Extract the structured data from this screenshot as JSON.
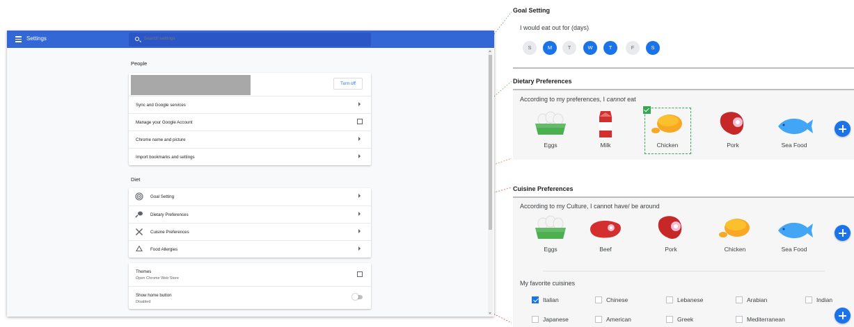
{
  "header": {
    "title": "Settings"
  },
  "search": {
    "placeholder": "Search settings"
  },
  "people": {
    "title": "People",
    "turn_off_label": "Turn off",
    "rows": [
      {
        "label": "Sync and Google services",
        "icon": "arrow-right-icon"
      },
      {
        "label": "Manage your Google Account",
        "icon": "open-external-icon"
      },
      {
        "label": "Chrome name and picture",
        "icon": "arrow-right-icon"
      },
      {
        "label": "Import bookmarks and settings",
        "icon": "arrow-right-icon"
      }
    ]
  },
  "diet": {
    "title": "Diet",
    "rows": [
      {
        "label": "Goal Setting",
        "icon": "target-icon"
      },
      {
        "label": "Dietary Preferences",
        "icon": "drumstick-icon"
      },
      {
        "label": "Cuisine Preferences",
        "icon": "utensils-icon"
      },
      {
        "label": "Food Allergies",
        "icon": "recycle-icon"
      }
    ]
  },
  "appearance": {
    "rows": [
      {
        "title": "Themes",
        "subtitle": "Open Chrome Web Store"
      },
      {
        "title": "Show home button",
        "subtitle": "Disabled"
      }
    ]
  },
  "goal_setting": {
    "title": "Goal Setting",
    "prompt": "I would eat out for (days)",
    "days": [
      {
        "label": "S",
        "selected": false
      },
      {
        "label": "M",
        "selected": true
      },
      {
        "label": "T",
        "selected": false
      },
      {
        "label": "W",
        "selected": true
      },
      {
        "label": "T",
        "selected": true
      },
      {
        "label": "F",
        "selected": false
      },
      {
        "label": "S",
        "selected": true
      }
    ]
  },
  "dietary_preferences": {
    "title": "Dietary Preferences",
    "prompt_before": "According to my preferences, I ",
    "prompt_emph": "cannot",
    "prompt_after": " eat",
    "items": [
      "Eggs",
      "Milk",
      "Chicken",
      "Pork",
      "Sea Food"
    ],
    "selected": "Chicken"
  },
  "cuisine_preferences": {
    "title": "Cuisine Preferences",
    "prompt": "According to my Culture, I cannot have/ be around",
    "items": [
      "Eggs",
      "Beef",
      "Pork",
      "Chicken",
      "Sea Food"
    ],
    "favorites_title": "My favorite cuisines",
    "cuisines": [
      {
        "label": "Italian",
        "checked": true
      },
      {
        "label": "Chinese",
        "checked": false
      },
      {
        "label": "Lebanese",
        "checked": false
      },
      {
        "label": "Arabian",
        "checked": false
      },
      {
        "label": "Indian",
        "checked": false
      },
      {
        "label": "Japanese",
        "checked": false
      },
      {
        "label": "American",
        "checked": false
      },
      {
        "label": "Greek",
        "checked": false
      },
      {
        "label": "Mediterranean",
        "checked": false
      }
    ]
  },
  "colors": {
    "accent": "#1a73e8",
    "header": "#3367d6",
    "selection": "#34a853"
  }
}
